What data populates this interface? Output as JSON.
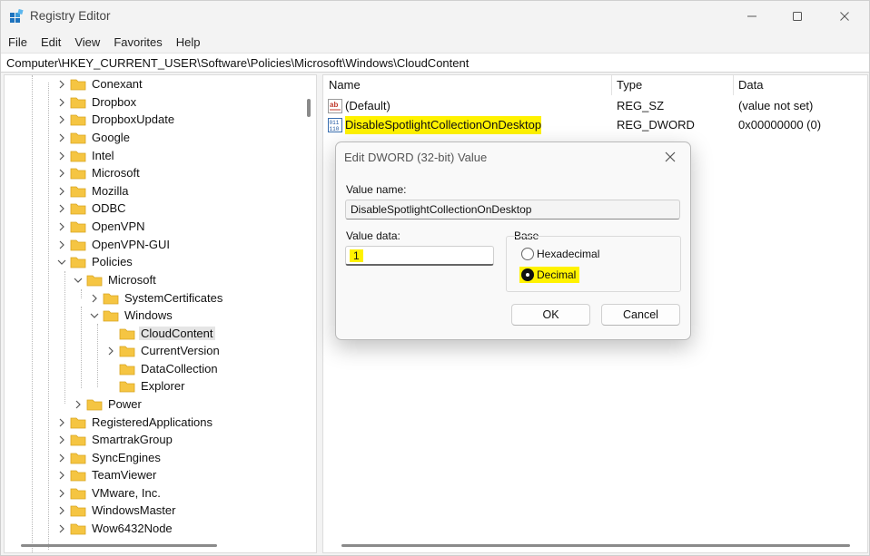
{
  "window": {
    "title": "Registry Editor",
    "controls": {
      "minimize": "minimize",
      "maximize": "maximize",
      "close": "close"
    }
  },
  "menu": [
    "File",
    "Edit",
    "View",
    "Favorites",
    "Help"
  ],
  "address": "Computer\\HKEY_CURRENT_USER\\Software\\Policies\\Microsoft\\Windows\\CloudContent",
  "tree": {
    "items": [
      {
        "label": "Conexant",
        "expanded": false,
        "level": 0
      },
      {
        "label": "Dropbox",
        "expanded": false,
        "level": 0
      },
      {
        "label": "DropboxUpdate",
        "expanded": false,
        "level": 0
      },
      {
        "label": "Google",
        "expanded": false,
        "level": 0
      },
      {
        "label": "Intel",
        "expanded": false,
        "level": 0
      },
      {
        "label": "Microsoft",
        "expanded": false,
        "level": 0
      },
      {
        "label": "Mozilla",
        "expanded": false,
        "level": 0
      },
      {
        "label": "ODBC",
        "expanded": false,
        "level": 0
      },
      {
        "label": "OpenVPN",
        "expanded": false,
        "level": 0
      },
      {
        "label": "OpenVPN-GUI",
        "expanded": false,
        "level": 0
      },
      {
        "label": "Policies",
        "expanded": true,
        "level": 0
      },
      {
        "label": "Microsoft",
        "expanded": true,
        "level": 1
      },
      {
        "label": "SystemCertificates",
        "expanded": false,
        "level": 2
      },
      {
        "label": "Windows",
        "expanded": true,
        "level": 2
      },
      {
        "label": "CloudContent",
        "expanded": null,
        "level": 3,
        "selected": true
      },
      {
        "label": "CurrentVersion",
        "expanded": false,
        "level": 3
      },
      {
        "label": "DataCollection",
        "expanded": null,
        "level": 3
      },
      {
        "label": "Explorer",
        "expanded": null,
        "level": 3
      },
      {
        "label": "Power",
        "expanded": false,
        "level": 1
      },
      {
        "label": "RegisteredApplications",
        "expanded": false,
        "level": 0
      },
      {
        "label": "SmartrakGroup",
        "expanded": false,
        "level": 0
      },
      {
        "label": "SyncEngines",
        "expanded": false,
        "level": 0
      },
      {
        "label": "TeamViewer",
        "expanded": false,
        "level": 0
      },
      {
        "label": "VMware, Inc.",
        "expanded": false,
        "level": 0
      },
      {
        "label": "WindowsMaster",
        "expanded": false,
        "level": 0
      },
      {
        "label": "Wow6432Node",
        "expanded": false,
        "level": 0
      }
    ]
  },
  "values": {
    "headers": {
      "name": "Name",
      "type": "Type",
      "data": "Data"
    },
    "rows": [
      {
        "name": "(Default)",
        "type": "REG_SZ",
        "data": "(value not set)",
        "icon": "string-value-icon"
      },
      {
        "name": "DisableSpotlightCollectionOnDesktop",
        "type": "REG_DWORD",
        "data": "0x00000000 (0)",
        "icon": "dword-value-icon",
        "highlighted": true
      }
    ]
  },
  "dialog": {
    "title": "Edit DWORD (32-bit) Value",
    "value_name_label": "Value name:",
    "value_name": "DisableSpotlightCollectionOnDesktop",
    "value_data_label": "Value data:",
    "value_data": "1",
    "base_label": "Base",
    "base_options": [
      {
        "label": "Hexadecimal",
        "checked": false
      },
      {
        "label": "Decimal",
        "checked": true
      }
    ],
    "ok_label": "OK",
    "cancel_label": "Cancel"
  },
  "colors": {
    "highlight": "#fff200",
    "folder": "#f5c542",
    "window_bg": "#f3f3f3"
  }
}
